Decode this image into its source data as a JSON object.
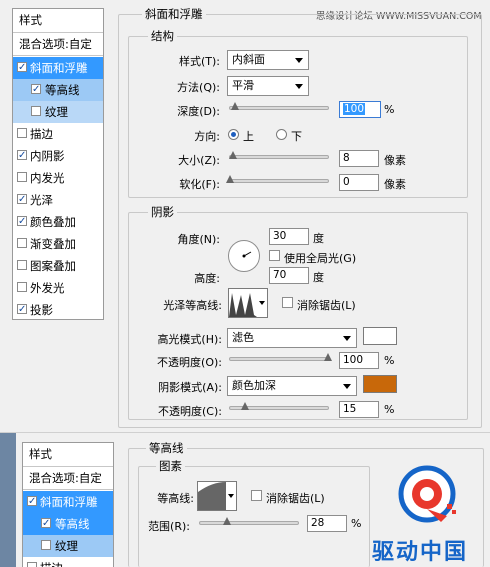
{
  "watermark": "思缘设计论坛 WWW.MISSVUAN.COM",
  "top_panel": {
    "list_header": "样式",
    "blend_options": "混合选项:自定",
    "items": [
      {
        "label": "斜面和浮雕",
        "checked": true
      },
      {
        "label": "等高线",
        "checked": true
      },
      {
        "label": "纹理",
        "checked": false
      },
      {
        "label": "描边",
        "checked": false
      },
      {
        "label": "内阴影",
        "checked": true
      },
      {
        "label": "内发光",
        "checked": false
      },
      {
        "label": "光泽",
        "checked": true
      },
      {
        "label": "颜色叠加",
        "checked": true
      },
      {
        "label": "渐变叠加",
        "checked": false
      },
      {
        "label": "图案叠加",
        "checked": false
      },
      {
        "label": "外发光",
        "checked": false
      },
      {
        "label": "投影",
        "checked": true
      }
    ],
    "section_title": "斜面和浮雕",
    "structure": {
      "title": "结构",
      "style_label": "样式(T):",
      "style_value": "内斜面",
      "method_label": "方法(Q):",
      "method_value": "平滑",
      "depth_label": "深度(D):",
      "depth_value": "100",
      "depth_unit": "%",
      "depth_level": 0.05,
      "direction_label": "方向:",
      "direction_up": "上",
      "direction_down": "下",
      "size_label": "大小(Z):",
      "size_value": "8",
      "size_unit": "像素",
      "size_level": 0.03,
      "soften_label": "软化(F):",
      "soften_value": "0",
      "soften_unit": "像素",
      "soften_level": 0.0
    },
    "shading": {
      "title": "阴影",
      "angle_label": "角度(N):",
      "angle_value": "30",
      "angle_unit": "度",
      "global_light_label": "使用全局光(G)",
      "altitude_label": "高度:",
      "altitude_value": "70",
      "altitude_unit": "度",
      "gloss_label": "光泽等高线:",
      "antialias_label": "消除锯齿(L)",
      "highlight_mode_label": "高光模式(H):",
      "highlight_mode_value": "滤色",
      "highlight_color": "#ffffff",
      "opacity1_label": "不透明度(O):",
      "opacity1_value": "100",
      "opacity1_unit": "%",
      "opacity1_level": 1.0,
      "shadow_mode_label": "阴影模式(A):",
      "shadow_mode_value": "颜色加深",
      "shadow_color": "#c8680a",
      "opacity2_label": "不透明度(C):",
      "opacity2_value": "15",
      "opacity2_unit": "%",
      "opacity2_level": 0.15
    }
  },
  "bottom_panel": {
    "list_header": "样式",
    "blend_options": "混合选项:自定",
    "items": [
      {
        "label": "斜面和浮雕",
        "checked": true
      },
      {
        "label": "等高线",
        "checked": true
      },
      {
        "label": "纹理",
        "checked": false
      },
      {
        "label": "描边",
        "checked": false
      }
    ],
    "section_title": "等高线",
    "elements_title": "图素",
    "contour_label": "等高线:",
    "antialias_label": "消除锯齿(L)",
    "range_label": "范围(R):",
    "range_value": "28",
    "range_unit": "%",
    "range_level": 0.28
  },
  "logo_text": "驱动中国",
  "accent": "#3399ff"
}
